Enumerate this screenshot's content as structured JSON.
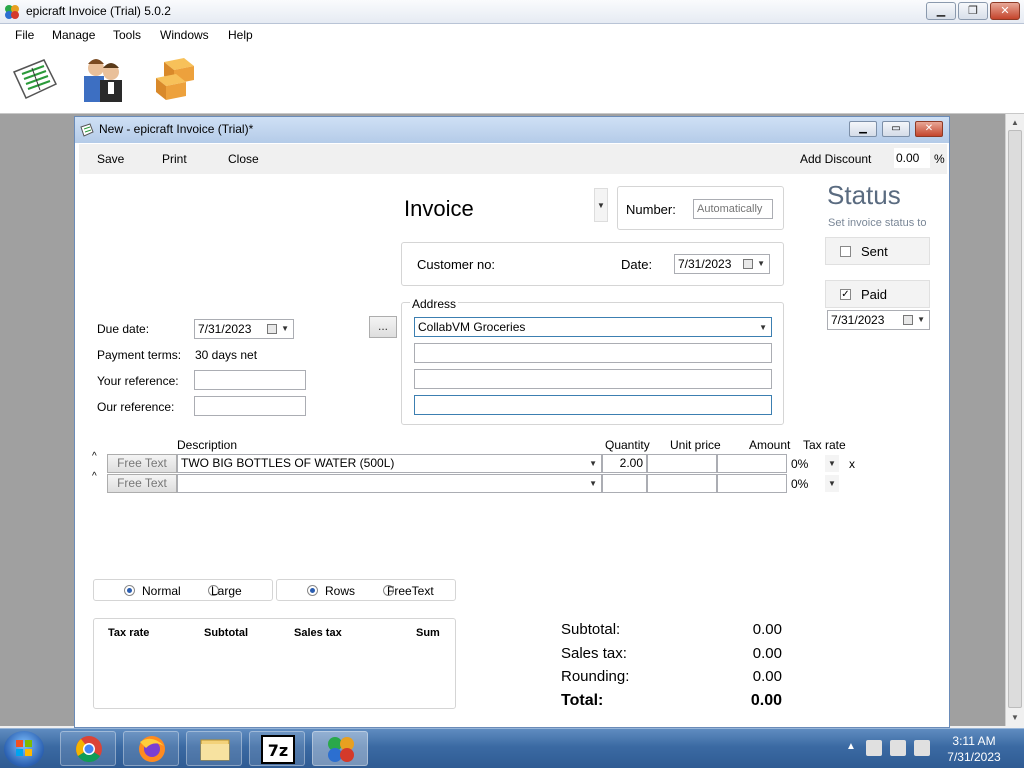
{
  "app": {
    "title": "epicraft Invoice (Trial) 5.0.2",
    "menu": [
      "File",
      "Manage",
      "Tools",
      "Windows",
      "Help"
    ],
    "toolbar_icons": [
      "invoice-list-icon",
      "customers-icon",
      "products-icon"
    ]
  },
  "child_window": {
    "title": "New - epicraft Invoice (Trial)*",
    "commands": {
      "save": "Save",
      "print": "Print",
      "close": "Close"
    },
    "discount_label": "Add Discount",
    "discount_value": "0.00",
    "discount_unit": "%"
  },
  "invoice": {
    "type_label": "Invoice",
    "number_label": "Number:",
    "number_placeholder": "Automatically",
    "customer_no_label": "Customer no:",
    "date_label": "Date:",
    "date_value": "7/31/2023",
    "address_label": "Address",
    "address_lines": [
      "CollabVM Groceries",
      "",
      "",
      ""
    ],
    "due_date_label": "Due date:",
    "due_date_value": "7/31/2023",
    "ellipsis": "...",
    "payment_terms_label": "Payment terms:",
    "payment_terms_value": "30 days net",
    "your_reference_label": "Your reference:",
    "our_reference_label": "Our reference:"
  },
  "status": {
    "heading": "Status",
    "subheading": "Set invoice status to",
    "sent_label": "Sent",
    "sent_checked": false,
    "paid_label": "Paid",
    "paid_checked": true,
    "paid_date": "7/31/2023"
  },
  "lines": {
    "headers": {
      "description": "Description",
      "quantity": "Quantity",
      "unit_price": "Unit price",
      "amount": "Amount",
      "tax_rate": "Tax rate"
    },
    "rows": [
      {
        "type": "Free Text",
        "description": "TWO BIG BOTTLES OF WATER (500L)",
        "quantity": "2.00",
        "unit_price": "",
        "amount": "",
        "tax": "0%",
        "remove": "x"
      },
      {
        "type": "Free Text",
        "description": "",
        "quantity": "",
        "unit_price": "",
        "amount": "",
        "tax": "0%",
        "remove": ""
      }
    ]
  },
  "view_options": {
    "size": {
      "normal": "Normal",
      "large": "Large",
      "selected": "Normal"
    },
    "mode": {
      "rows": "Rows",
      "freetext": "FreeText",
      "selected": "Rows"
    }
  },
  "tax_table": {
    "headers": [
      "Tax rate",
      "Subtotal",
      "Sales tax",
      "Sum"
    ]
  },
  "totals": {
    "subtotal_label": "Subtotal:",
    "subtotal": "0.00",
    "sales_tax_label": "Sales tax:",
    "sales_tax": "0.00",
    "rounding_label": "Rounding:",
    "rounding": "0.00",
    "total_label": "Total:",
    "total": "0.00"
  },
  "taskbar": {
    "apps": [
      "chrome-icon",
      "firefox-icon",
      "explorer-icon",
      "7zip-icon",
      "epicraft-icon"
    ],
    "time": "3:11 AM",
    "date": "7/31/2023"
  }
}
